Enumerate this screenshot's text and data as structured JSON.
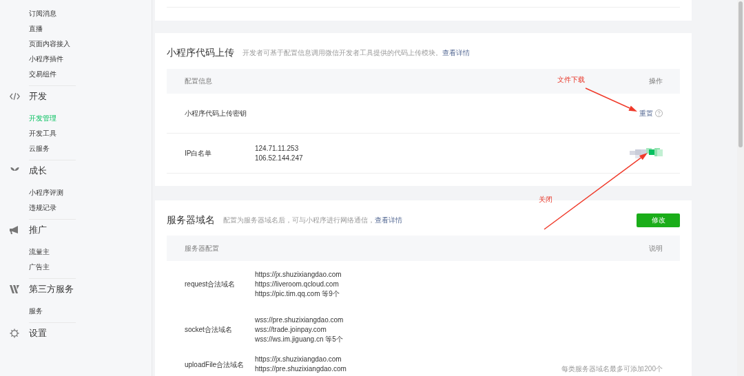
{
  "sidebar": {
    "groups": [
      {
        "items": [
          {
            "label": "订阅消息",
            "selected": false
          },
          {
            "label": "直播",
            "selected": false
          },
          {
            "label": "页面内容接入",
            "selected": false
          },
          {
            "label": "小程序插件",
            "selected": false
          },
          {
            "label": "交易组件",
            "selected": false
          }
        ]
      },
      {
        "heading": {
          "label": "开发"
        },
        "items": [
          {
            "label": "开发管理",
            "selected": true
          },
          {
            "label": "开发工具",
            "selected": false
          },
          {
            "label": "云服务",
            "selected": false
          }
        ]
      },
      {
        "heading": {
          "label": "成长"
        },
        "items": [
          {
            "label": "小程序评测",
            "selected": false
          },
          {
            "label": "违规记录",
            "selected": false
          }
        ]
      },
      {
        "heading": {
          "label": "推广"
        },
        "items": [
          {
            "label": "流量主",
            "selected": false
          },
          {
            "label": "广告主",
            "selected": false
          }
        ]
      },
      {
        "heading": {
          "label": "第三方服务"
        },
        "items": [
          {
            "label": "服务",
            "selected": false
          }
        ]
      },
      {
        "heading": {
          "label": "设置"
        }
      }
    ]
  },
  "code_upload": {
    "title": "小程序代码上传",
    "description": "开发者可基于配置信息调用微信开发者工具提供的代码上传模块。",
    "link": "查看详情",
    "columns": [
      "配置信息",
      "操作"
    ],
    "rows": [
      {
        "label": "小程序代码上传密钥",
        "values": [],
        "action": {
          "kind": "link",
          "text": "重置"
        }
      },
      {
        "label": "IP白名单",
        "values": [
          "124.71.11.253",
          "106.52.144.247"
        ],
        "action": {
          "kind": "pixelated",
          "on": true
        }
      }
    ]
  },
  "server_domains": {
    "title": "服务器域名",
    "description": "配置为服务器域名后，可与小程序进行网络通信，",
    "link": "查看详情",
    "button": "修改",
    "columns": [
      "服务器配置",
      "说明"
    ],
    "rows": [
      {
        "label": "request合法域名",
        "values": [
          "https://jx.shuzixiangdao.com",
          "https://liveroom.qcloud.com",
          "https://pic.tim.qq.com 等9个"
        ]
      },
      {
        "label": "socket合法域名",
        "values": [
          "wss://pre.shuzixiangdao.com",
          "wss://trade.joinpay.com",
          "wss://ws.im.jiguang.cn 等5个"
        ]
      },
      {
        "label": "uploadFile合法域名",
        "values": [
          "https://jx.shuzixiangdao.com",
          "https://pre.shuzixiangdao.com"
        ],
        "note": "每类服务器域名最多可添加200个"
      }
    ]
  },
  "annotations": [
    {
      "text": "文件下载"
    },
    {
      "text": "关闭"
    }
  ]
}
